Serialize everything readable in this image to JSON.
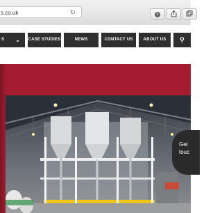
{
  "browser": {
    "url": "s.co.uk",
    "reload_glyph": "↻",
    "buttons": [
      "info-icon",
      "share-icon",
      "tabs-icon"
    ]
  },
  "nav": {
    "items": [
      {
        "label": "S"
      },
      {
        "label": "CASE STUDIES"
      },
      {
        "label": "NEWS"
      },
      {
        "label": "CONTACT US"
      },
      {
        "label": "ABOUT US"
      }
    ],
    "dropdown_glyph": "⌄",
    "search_glyph": "⚲"
  },
  "hero": {
    "accent_color": "#a51c30",
    "cta_text_line1": "Get",
    "cta_text_line2": "touc"
  }
}
